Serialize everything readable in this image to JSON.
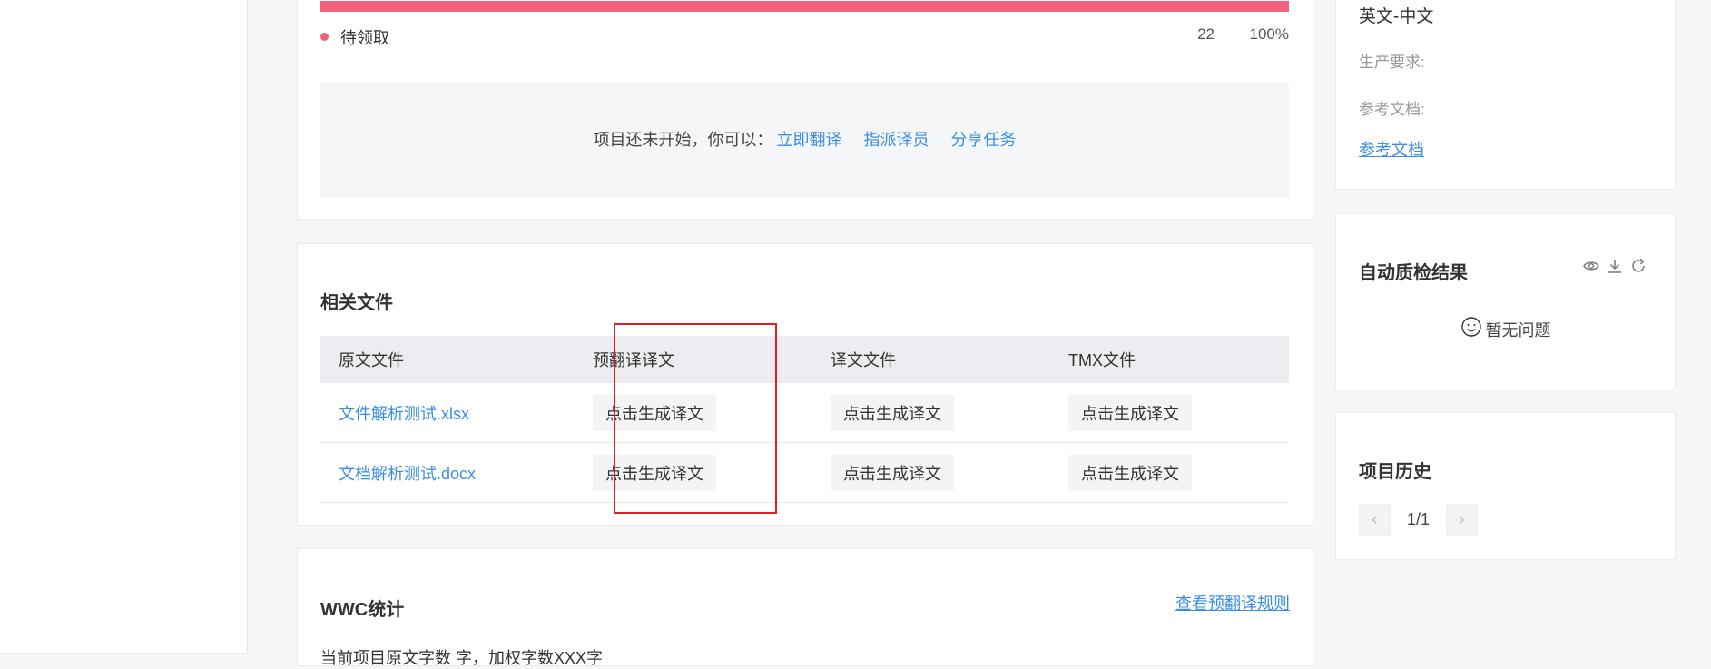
{
  "progress": {
    "status_label": "待领取",
    "count": "22",
    "percent": "100%",
    "bar_fill_fraction": 1.0,
    "colors": {
      "bar": "#f2637b"
    }
  },
  "notice": {
    "text": "项目还未开始，你可以：",
    "actions": [
      "立即翻译",
      "指派译员",
      "分享任务"
    ]
  },
  "files": {
    "title": "相关文件",
    "headers": [
      "原文文件",
      "预翻译译文",
      "译文文件",
      "TMX文件"
    ],
    "rows": [
      {
        "name": "文件解析测试.xlsx",
        "btn1": "点击生成译文",
        "btn2": "点击生成译文",
        "btn3": "点击生成译文"
      },
      {
        "name": "文档解析测试.docx",
        "btn1": "点击生成译文",
        "btn2": "点击生成译文",
        "btn3": "点击生成译文"
      }
    ]
  },
  "wwc": {
    "title": "WWC统计",
    "link": "查看预翻译规则",
    "desc": "当前项目原文字数 字，加权字数XXX字"
  },
  "info": {
    "language": "英文-中文",
    "requirement_label": "生产要求:",
    "reference_label": "参考文档:",
    "reference_link": "参考文档"
  },
  "qa": {
    "title": "自动质检结果",
    "empty_text": "暂无问题",
    "icons": [
      "eye-icon",
      "download-icon",
      "refresh-icon"
    ]
  },
  "history": {
    "title": "项目历史",
    "page": "1/1"
  },
  "colors": {
    "link": "#3a8ee6",
    "highlight": "#e02020"
  }
}
